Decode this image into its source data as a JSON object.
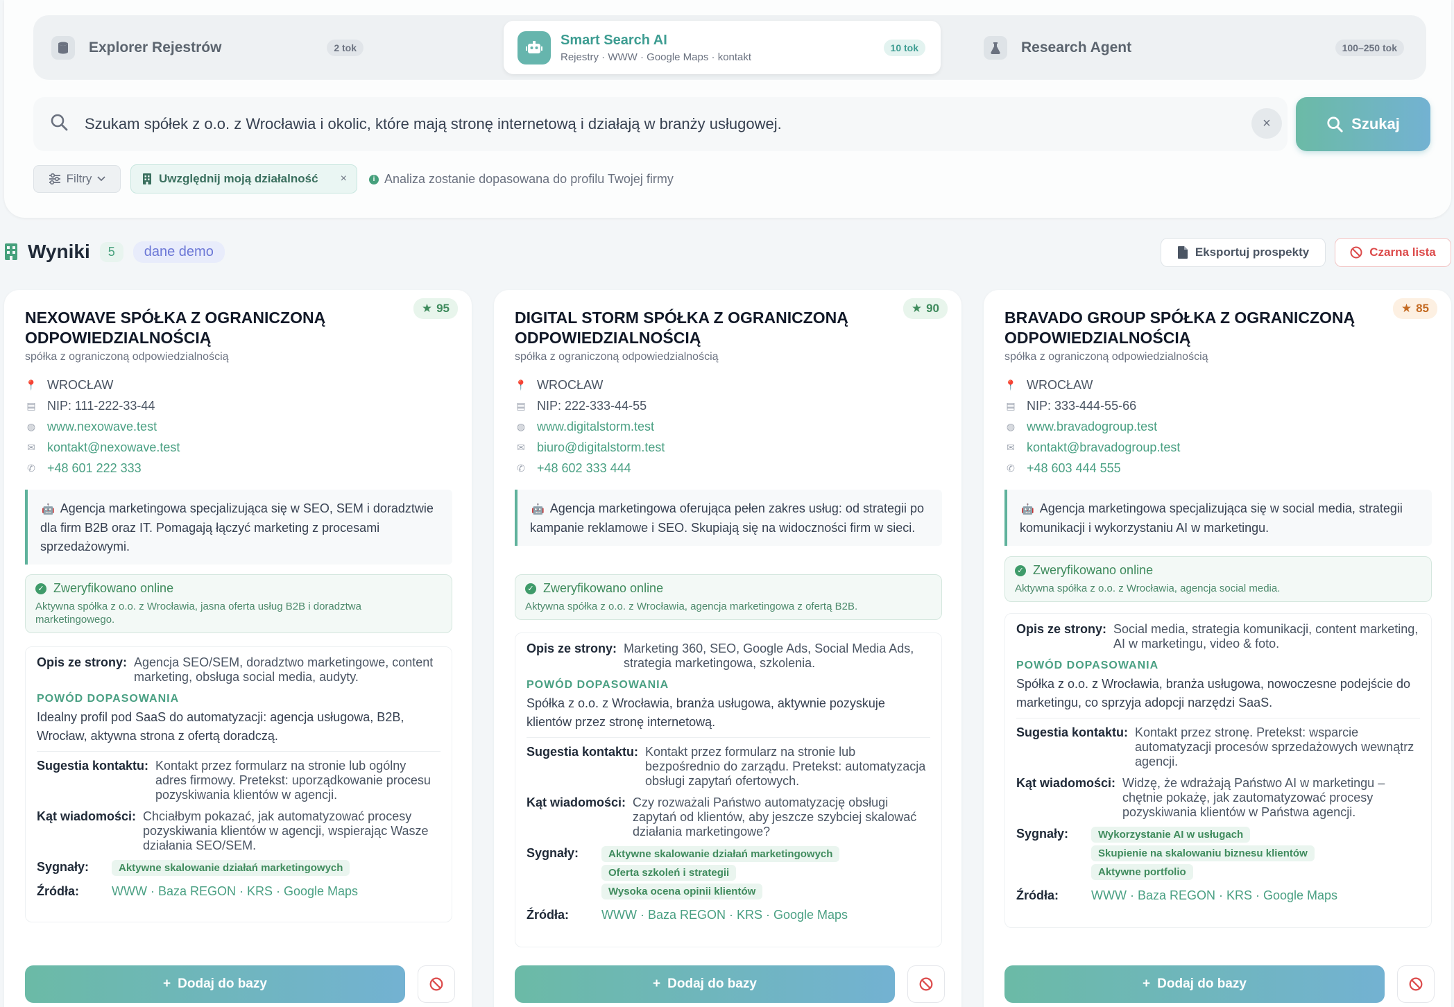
{
  "modes": [
    {
      "title": "Explorer Rejestrów",
      "badge": "2 tok",
      "icon": "database-icon"
    },
    {
      "title": "Smart Search AI",
      "subtitle": "Rejestry · WWW · Google Maps · kontakt",
      "badge": "10 tok",
      "icon": "robot-icon"
    },
    {
      "title": "Research Agent",
      "badge": "100–250 tok",
      "icon": "flask-icon"
    }
  ],
  "search": {
    "query": "Szukam spółek z o.o. z Wrocławia i okolic, które mają stronę internetową i działają w branży usługowej.",
    "button": "Szukaj",
    "clear": "×"
  },
  "filters": {
    "label": "Filtry",
    "chip": "Uwzględnij moją działalność",
    "hint": "Analiza zostanie dopasowana do profilu Twojej firmy"
  },
  "results": {
    "title": "Wyniki",
    "count": "5",
    "demo": "dane demo",
    "export": "Eksportuj prospekty",
    "blacklist": "Czarna lista"
  },
  "labels": {
    "site_desc": "Opis ze strony:",
    "why": "POWÓD DOPASOWANIA",
    "contact": "Sugestia kontaktu:",
    "angle": "Kąt wiadomości:",
    "signals": "Sygnały:",
    "sources": "Źródła:",
    "add": "Dodaj do bazy"
  },
  "colors": {
    "accent": "#4aa083",
    "score_high": "#3f8b5d",
    "score_mid": "#c46a22",
    "danger": "#dc4b4b"
  },
  "cards": [
    {
      "name": "NEXOWAVE SPÓŁKA Z OGRANICZONĄ ODPOWIEDZIALNOŚCIĄ",
      "score": "95",
      "legal": "spółka z ograniczoną odpowiedzialnością",
      "city": "WROCŁAW",
      "nip": "NIP: 111-222-33-44",
      "www": "www.nexowave.test",
      "email": "kontakt@nexowave.test",
      "phone": "+48 601 222 333",
      "desc": "Agencja marketingowa specjalizująca się w SEO, SEM i doradztwie dla firm B2B oraz IT. Pomagają łączyć marketing z procesami sprzedażowymi.",
      "verified": "Zweryfikowano online",
      "verified_sub": "Aktywna spółka z o.o. z Wrocławia, jasna oferta usług B2B i doradztwa marketingowego.",
      "site_desc": "Agencja SEO/SEM, doradztwo marketingowe, content marketing, obsługa social media, audyty.",
      "why": "Idealny profil pod SaaS do automatyzacji: agencja usługowa, B2B, Wrocław, aktywna strona z ofertą doradczą.",
      "contact": "Kontakt przez formularz na stronie lub ogólny adres firmowy. Pretekst: uporządkowanie procesu pozyskiwania klientów w agencji.",
      "angle": "Chciałbym pokazać, jak automatyzować procesy pozyskiwania klientów w agencji, wspierając Wasze działania SEO/SEM.",
      "signals": [
        "Aktywne skalowanie działań marketingowych"
      ],
      "sources": "WWW · Baza REGON · KRS · Google Maps"
    },
    {
      "name": "DIGITAL STORM SPÓŁKA Z OGRANICZONĄ ODPOWIEDZIALNOŚCIĄ",
      "score": "90",
      "legal": "spółka z ograniczoną odpowiedzialnością",
      "city": "WROCŁAW",
      "nip": "NIP: 222-333-44-55",
      "www": "www.digitalstorm.test",
      "email": "biuro@digitalstorm.test",
      "phone": "+48 602 333 444",
      "desc": "Agencja marketingowa oferująca pełen zakres usług: od strategii po kampanie reklamowe i SEO. Skupiają się na widoczności firm w sieci.",
      "verified": "Zweryfikowano online",
      "verified_sub": "Aktywna spółka z o.o. z Wrocławia, agencja marketingowa z ofertą B2B.",
      "site_desc": "Marketing 360, SEO, Google Ads, Social Media Ads, strategia marketingowa, szkolenia.",
      "why": "Spółka z o.o. z Wrocławia, branża usługowa, aktywnie pozyskuje klientów przez stronę internetową.",
      "contact": "Kontakt przez formularz na stronie lub bezpośrednio do zarządu. Pretekst: automatyzacja obsługi zapytań ofertowych.",
      "angle": "Czy rozważali Państwo automatyzację obsługi zapytań od klientów, aby jeszcze szybciej skalować działania marketingowe?",
      "signals": [
        "Aktywne skalowanie działań marketingowych",
        "Oferta szkoleń i strategii",
        "Wysoka ocena opinii klientów"
      ],
      "sources": "WWW · Baza REGON · KRS · Google Maps"
    },
    {
      "name": "BRAVADO GROUP SPÓŁKA Z OGRANICZONĄ ODPOWIEDZIALNOŚCIĄ",
      "score": "85",
      "legal": "spółka z ograniczoną odpowiedzialnością",
      "city": "WROCŁAW",
      "nip": "NIP: 333-444-55-66",
      "www": "www.bravadogroup.test",
      "email": "kontakt@bravadogroup.test",
      "phone": "+48 603 444 555",
      "desc": "Agencja marketingowa specjalizująca się w social media, strategii komunikacji i wykorzystaniu AI w marketingu.",
      "verified": "Zweryfikowano online",
      "verified_sub": "Aktywna spółka z o.o. z Wrocławia, agencja social media.",
      "site_desc": "Social media, strategia komunikacji, content marketing, AI w marketingu, video & foto.",
      "why": "Spółka z o.o. z Wrocławia, branża usługowa, nowoczesne podejście do marketingu, co sprzyja adopcji narzędzi SaaS.",
      "contact": "Kontakt przez stronę. Pretekst: wsparcie automatyzacji procesów sprzedażowych wewnątrz agencji.",
      "angle": "Widzę, że wdrażają Państwo AI w marketingu – chętnie pokażę, jak zautomatyzować procesy pozyskiwania klientów w Państwa agencji.",
      "signals": [
        "Wykorzystanie AI w usługach",
        "Skupienie na skalowaniu biznesu klientów",
        "Aktywne portfolio"
      ],
      "sources": "WWW · Baza REGON · KRS · Google Maps"
    }
  ]
}
